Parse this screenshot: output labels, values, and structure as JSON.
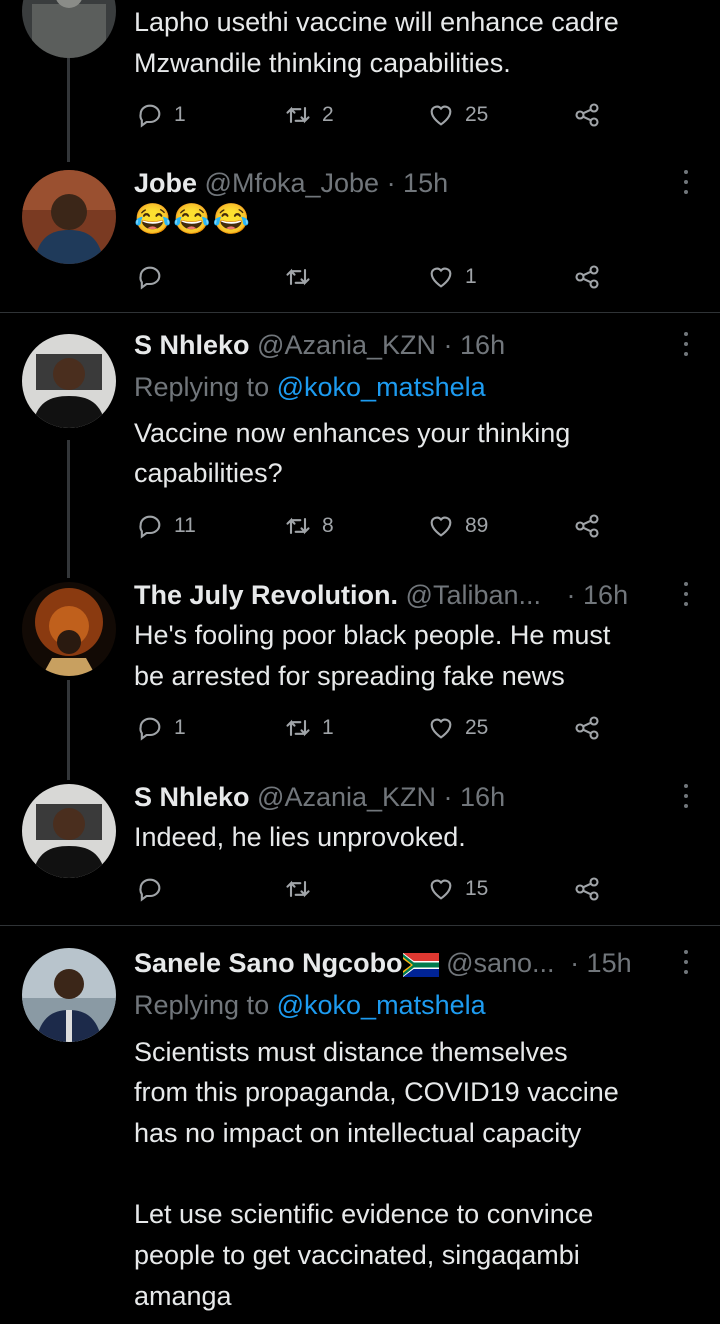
{
  "tweets": [
    {
      "text_lines": [
        "Lapho usethi vaccine will enhance cadre",
        "Mzwandile thinking capabilities."
      ],
      "reply_count": "1",
      "retweet_count": "2",
      "like_count": "25"
    },
    {
      "name": "Jobe",
      "handle": "@Mfoka_Jobe",
      "time": "· 15h",
      "emoji": "😂😂😂",
      "reply_count": "",
      "retweet_count": "",
      "like_count": "1"
    },
    {
      "name": "S Nhleko",
      "handle": "@Azania_KZN",
      "time": "· 16h",
      "replying_prefix": "Replying to",
      "replying_to": "@koko_matshela",
      "text_lines": [
        "Vaccine now enhances your thinking",
        "capabilities?"
      ],
      "reply_count": "11",
      "retweet_count": "8",
      "like_count": "89"
    },
    {
      "name": "The July Revolution.",
      "handle": "@Taliban...",
      "time": "· 16h",
      "text_lines": [
        "He's fooling poor black people. He must",
        "be arrested for spreading fake news"
      ],
      "reply_count": "1",
      "retweet_count": "1",
      "like_count": "25"
    },
    {
      "name": "S Nhleko",
      "handle": "@Azania_KZN",
      "time": "· 16h",
      "text_lines": [
        "Indeed, he lies unprovoked."
      ],
      "reply_count": "",
      "retweet_count": "",
      "like_count": "15"
    },
    {
      "name": "Sanele Sano Ngcobo",
      "handle": "@sano...",
      "time": "· 15h",
      "replying_prefix": "Replying to",
      "replying_to": "@koko_matshela",
      "text_lines": [
        "Scientists must distance themselves",
        "from this propaganda, COVID19 vaccine",
        "has no impact on intellectual capacity",
        "",
        "Let use scientific evidence to convince",
        "people to get vaccinated, singaqambi",
        "amanga"
      ]
    }
  ],
  "colors": {
    "background": "#000000",
    "text": "#e7e9ea",
    "muted": "#71767b",
    "link": "#1d9bf0",
    "divider": "#2f3336"
  },
  "icons": [
    "reply-icon",
    "retweet-icon",
    "like-icon",
    "share-icon",
    "more-icon",
    "south-africa-flag-icon"
  ]
}
